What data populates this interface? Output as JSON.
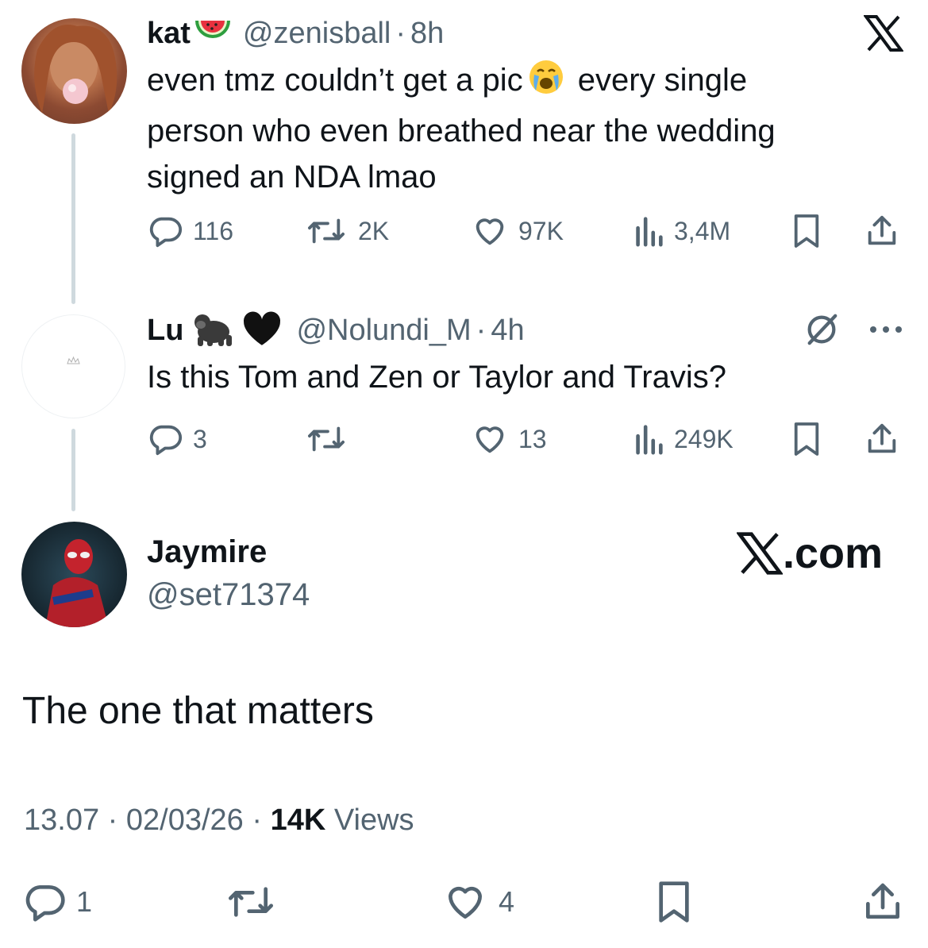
{
  "tweet1": {
    "name": "kat",
    "handle": "@zenisball",
    "time": "8h",
    "dot": "·",
    "text_part1": "even tmz couldn’t get a pic",
    "text_part2": " every single",
    "text_line2": "person who even breathed near the wedding",
    "text_line3": "signed an NDA lmao",
    "replies": "116",
    "reposts": "2K",
    "likes": "97K",
    "views": "3,4M"
  },
  "tweet2": {
    "name": "Lu",
    "handle": "@Nolundi_M",
    "time": "4h",
    "dot": "·",
    "text": "Is this Tom and Zen or Taylor and Travis?",
    "replies": "3",
    "reposts": "",
    "likes": "13",
    "views": "249K"
  },
  "main_tweet": {
    "name": "Jaymire",
    "handle": "@set71374",
    "brand": "X.com",
    "text": "The one that matters",
    "time": "13.07",
    "date": "02/03/26",
    "dot": "·",
    "views_count": "14K",
    "views_label": " Views",
    "replies": "1",
    "reposts": "",
    "likes": "4"
  },
  "colors": {
    "text_primary": "#0f1419",
    "text_secondary": "#536471",
    "thread_line": "#cfd9de"
  },
  "icons": [
    "x-logo-icon",
    "reply-icon",
    "repost-icon",
    "like-icon",
    "views-icon",
    "bookmark-icon",
    "share-icon",
    "grok-icon",
    "more-icon",
    "watermelon-icon",
    "crying-face-icon",
    "gorilla-icon",
    "black-heart-icon"
  ]
}
